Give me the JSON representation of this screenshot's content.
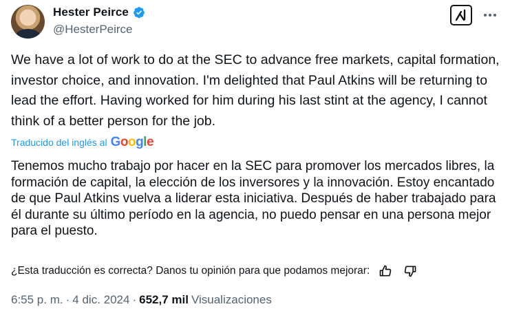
{
  "author": {
    "name": "Hester Peirce",
    "handle": "@HesterPeirce"
  },
  "icons": {
    "avatar": "avatar-photo",
    "verified": "verified-badge-icon",
    "grok": "grok-icon",
    "more": "more-options-icon",
    "thumb_up": "thumb-up-icon",
    "thumb_down": "thumb-down-icon"
  },
  "colors": {
    "verified": "#1d9bf0",
    "link": "#1d9bf0",
    "secondary_text": "#536471"
  },
  "tweet": {
    "text": "We have a lot of work to do at the SEC to advance free markets, capital formation, investor choice, and innovation. I'm delighted that Paul Atkins will be returning to lead the effort. Having worked for him during his last stint at the agency, I cannot think of a better person for the job."
  },
  "translation": {
    "label": "Traducido del inglés al",
    "provider": "Google",
    "text": "Tenemos mucho trabajo por hacer en la SEC para promover los mercados libres, la formación de capital, la elección de los inversores y la innovación. Estoy encantado de que Paul Atkins vuelva a liderar esta iniciativa. Después de haber trabajado para él durante su último período en la agencia, no puedo pensar en una persona mejor para el puesto.",
    "feedback_question": "¿Esta traducción es correcta? Danos tu opinión para que podamos mejorar:"
  },
  "meta": {
    "time": "6:55 p. m.",
    "separator": "·",
    "date": "4 dic. 2024",
    "views_count": "652,7 mil",
    "views_label": "Visualizaciones"
  }
}
